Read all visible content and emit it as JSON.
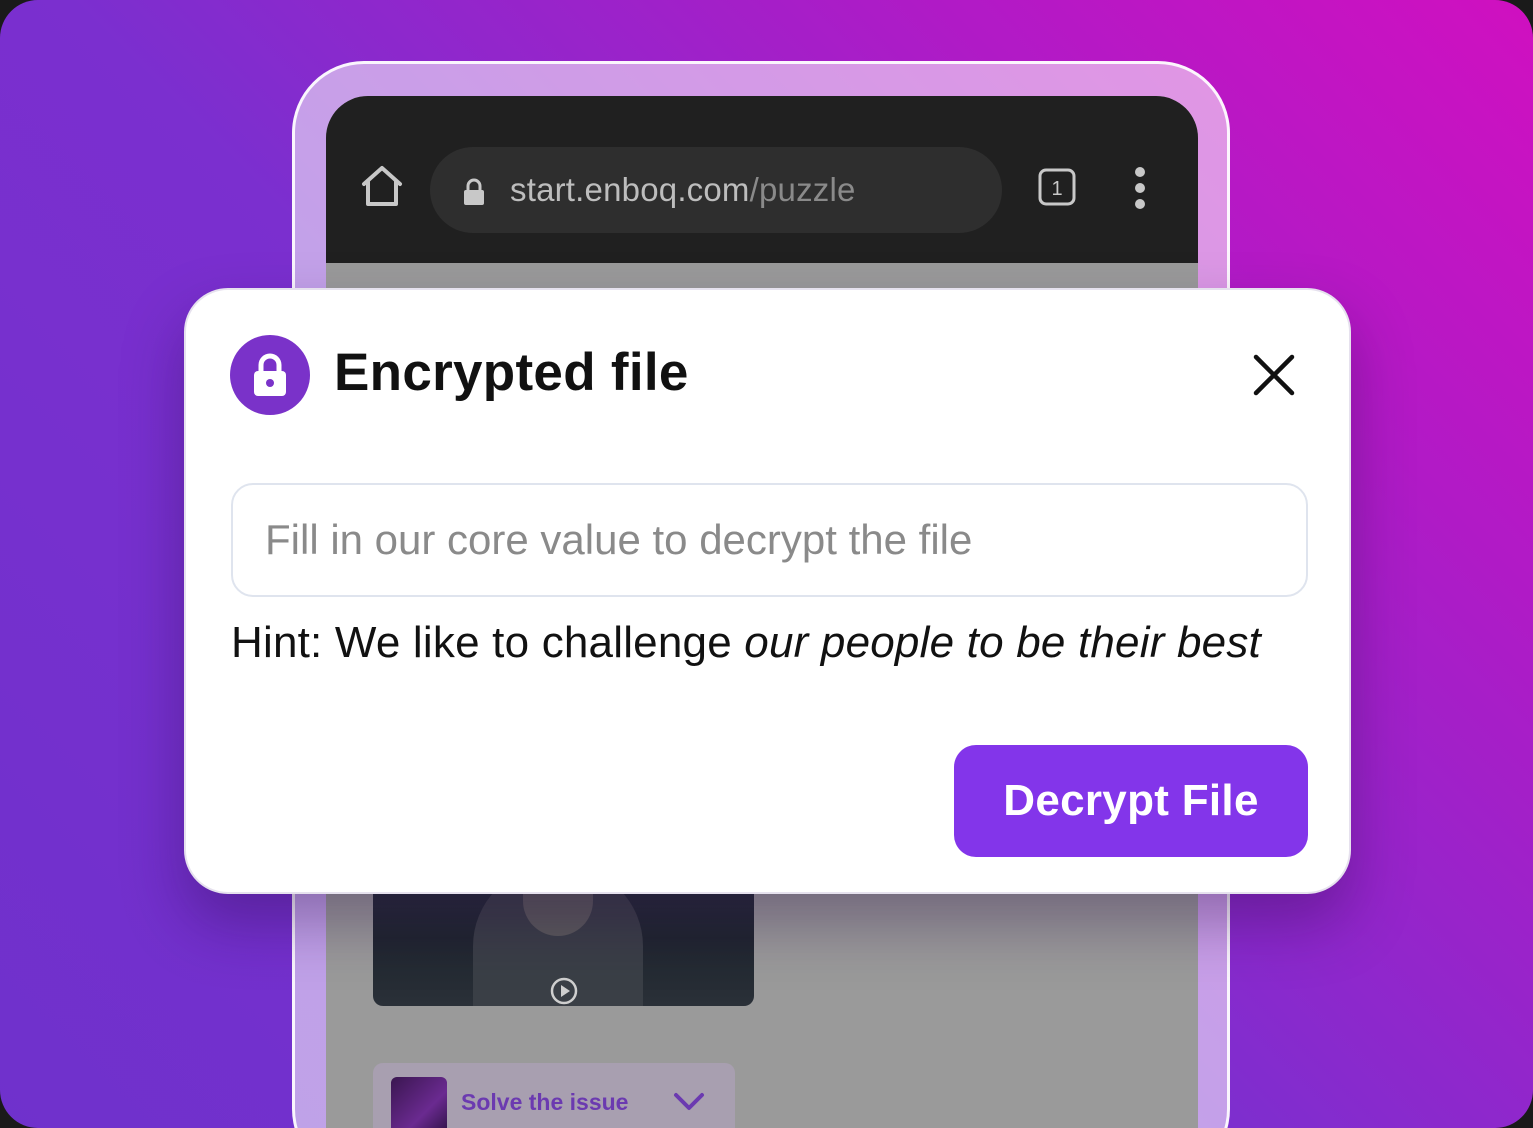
{
  "browser": {
    "url_host": "start.enboq.com",
    "url_path": "/puzzle",
    "tab_count": "1",
    "icons": {
      "home": "home-icon",
      "lock": "lock-icon",
      "tabs": "tabs-icon",
      "menu": "more-vert-icon"
    }
  },
  "page": {
    "solve_label": "Solve the issue"
  },
  "modal": {
    "title": "Encrypted file",
    "input_placeholder": "Fill in our core value to decrypt the file",
    "input_value": "",
    "hint_prefix": "Hint: We like to challenge ",
    "hint_italic": "our people to be their best",
    "button_label": "Decrypt File",
    "icons": {
      "badge": "lock-icon",
      "close": "close-icon"
    }
  },
  "colors": {
    "accent": "#8335ea",
    "badge": "#7a32c9",
    "background_start": "#d010c0",
    "background_end": "#6f31cc"
  }
}
